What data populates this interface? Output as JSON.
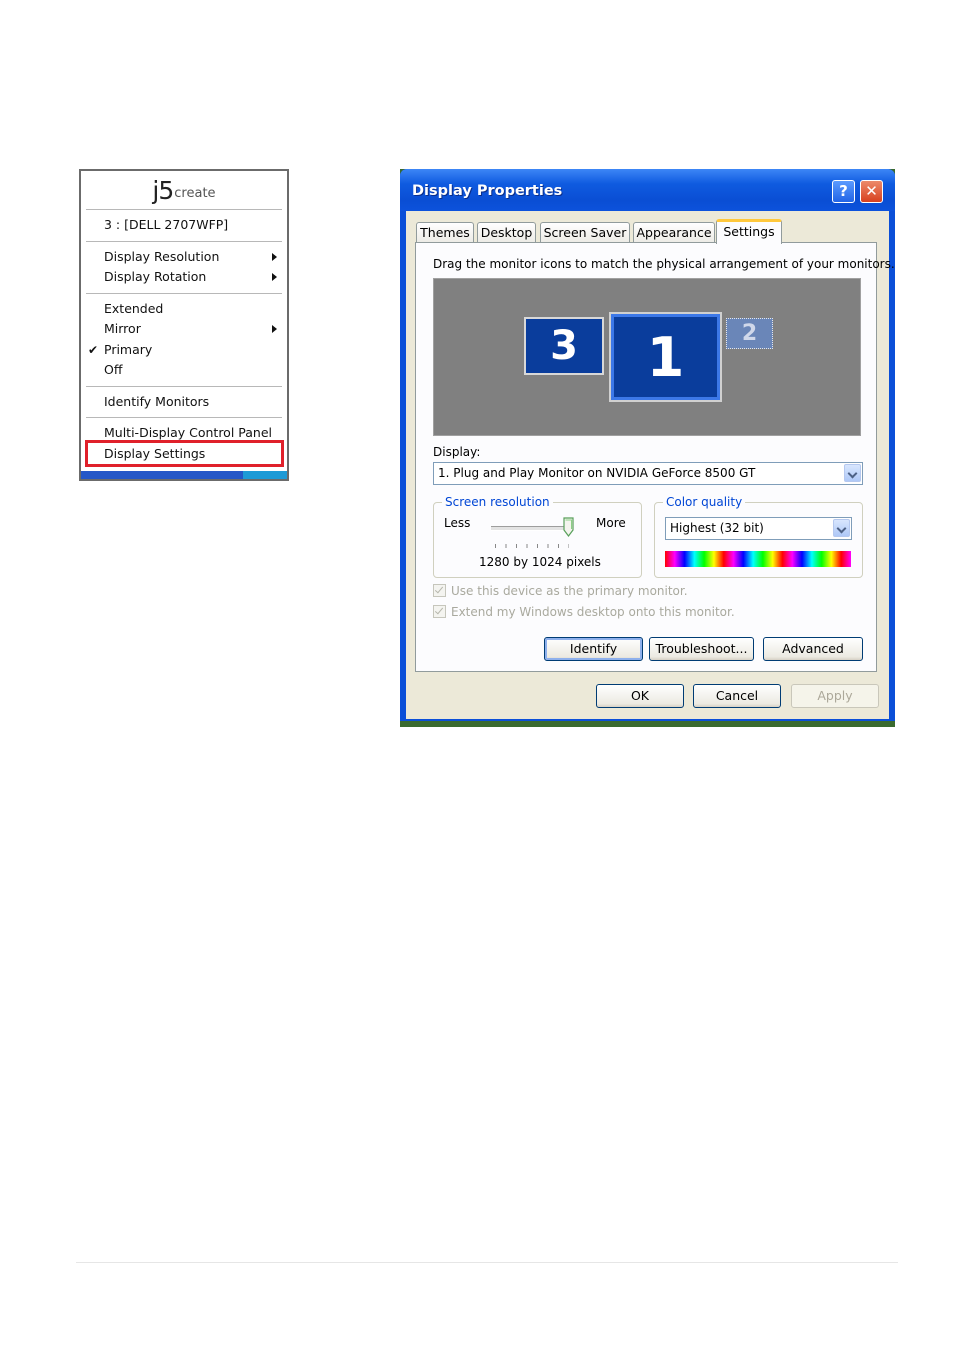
{
  "context_menu": {
    "logo": {
      "j5": "j5",
      "suffix": "create"
    },
    "monitor_label": "3 : [DELL 2707WFP]",
    "items_group1": [
      {
        "label": "Display Resolution",
        "has_submenu": true
      },
      {
        "label": "Display Rotation",
        "has_submenu": true
      }
    ],
    "items_group2": [
      {
        "label": "Extended",
        "has_submenu": false,
        "checked": false
      },
      {
        "label": "Mirror",
        "has_submenu": true,
        "checked": false
      },
      {
        "label": "Primary",
        "has_submenu": false,
        "checked": true
      },
      {
        "label": "Off",
        "has_submenu": false,
        "checked": false
      }
    ],
    "identify_monitors": "Identify Monitors",
    "multi_display_control_panel": "Multi-Display Control Panel",
    "display_settings": "Display Settings",
    "checkmark": "✔",
    "highlight_color": "#e0202a"
  },
  "window": {
    "title": "Display Properties",
    "help_button": "?",
    "close_button": "✕",
    "tabs": [
      {
        "label": "Themes",
        "active": false
      },
      {
        "label": "Desktop",
        "active": false
      },
      {
        "label": "Screen Saver",
        "active": false
      },
      {
        "label": "Appearance",
        "active": false
      },
      {
        "label": "Settings",
        "active": true
      }
    ],
    "instruction": "Drag the monitor icons to match the physical arrangement of your monitors.",
    "monitors": [
      {
        "number": "3",
        "selected": false
      },
      {
        "number": "1",
        "selected": true
      },
      {
        "number": "2",
        "selected": false,
        "disabled": true
      }
    ],
    "display_label": "Display:",
    "display_value": "1. Plug and Play Monitor on NVIDIA GeForce 8500 GT",
    "screen_resolution": {
      "title": "Screen resolution",
      "less": "Less",
      "more": "More",
      "value": "1280 by 1024 pixels",
      "slider_fraction": 1.0
    },
    "color_quality": {
      "title": "Color quality",
      "value": "Highest (32 bit)"
    },
    "checkbox_primary": "Use this device as the primary monitor.",
    "checkbox_extend": "Extend my Windows desktop onto this monitor.",
    "buttons": {
      "identify": "Identify",
      "troubleshoot": "Troubleshoot...",
      "advanced": "Advanced",
      "ok": "OK",
      "cancel": "Cancel",
      "apply": "Apply"
    },
    "colors": {
      "title_bar": "#0a4ed4",
      "tab_active_accent": "#ffc83c",
      "group_title": "#0046d5",
      "monitor_fill": "#0a3d9c",
      "desktop_area": "#808080"
    }
  }
}
